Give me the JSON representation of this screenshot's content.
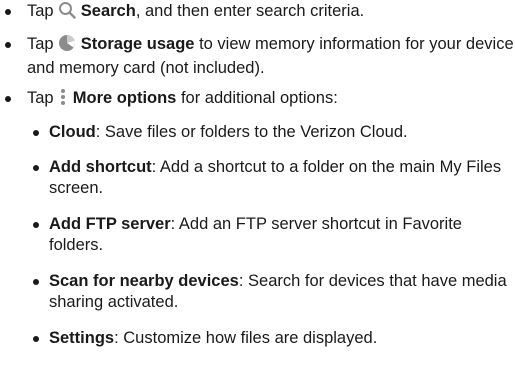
{
  "items": [
    {
      "pre": "Tap ",
      "icon": "search-icon",
      "term": "Search",
      "rest": ", and then enter search criteria."
    },
    {
      "pre": "Tap ",
      "icon": "storage-usage-icon",
      "term": "Storage usage",
      "rest": " to view memory information for your device and memory card (not included)."
    },
    {
      "pre": "Tap ",
      "icon": "more-options-icon",
      "term": "More options",
      "rest": " for additional options:"
    }
  ],
  "sub_items": [
    {
      "term": "Cloud",
      "rest": ": Save files or folders to the Verizon Cloud."
    },
    {
      "term": "Add shortcut",
      "rest": ": Add a shortcut to a folder on the main My Files screen."
    },
    {
      "term": "Add FTP server",
      "rest": ": Add an FTP server shortcut in Favorite folders."
    },
    {
      "term": "Scan for nearby devices",
      "rest": ": Search for devices that have media sharing activated."
    },
    {
      "term": "Settings",
      "rest": ": Customize how files are displayed."
    }
  ],
  "colors": {
    "icon_gray": "#8c8c8c",
    "text": "#1a1a1a"
  }
}
